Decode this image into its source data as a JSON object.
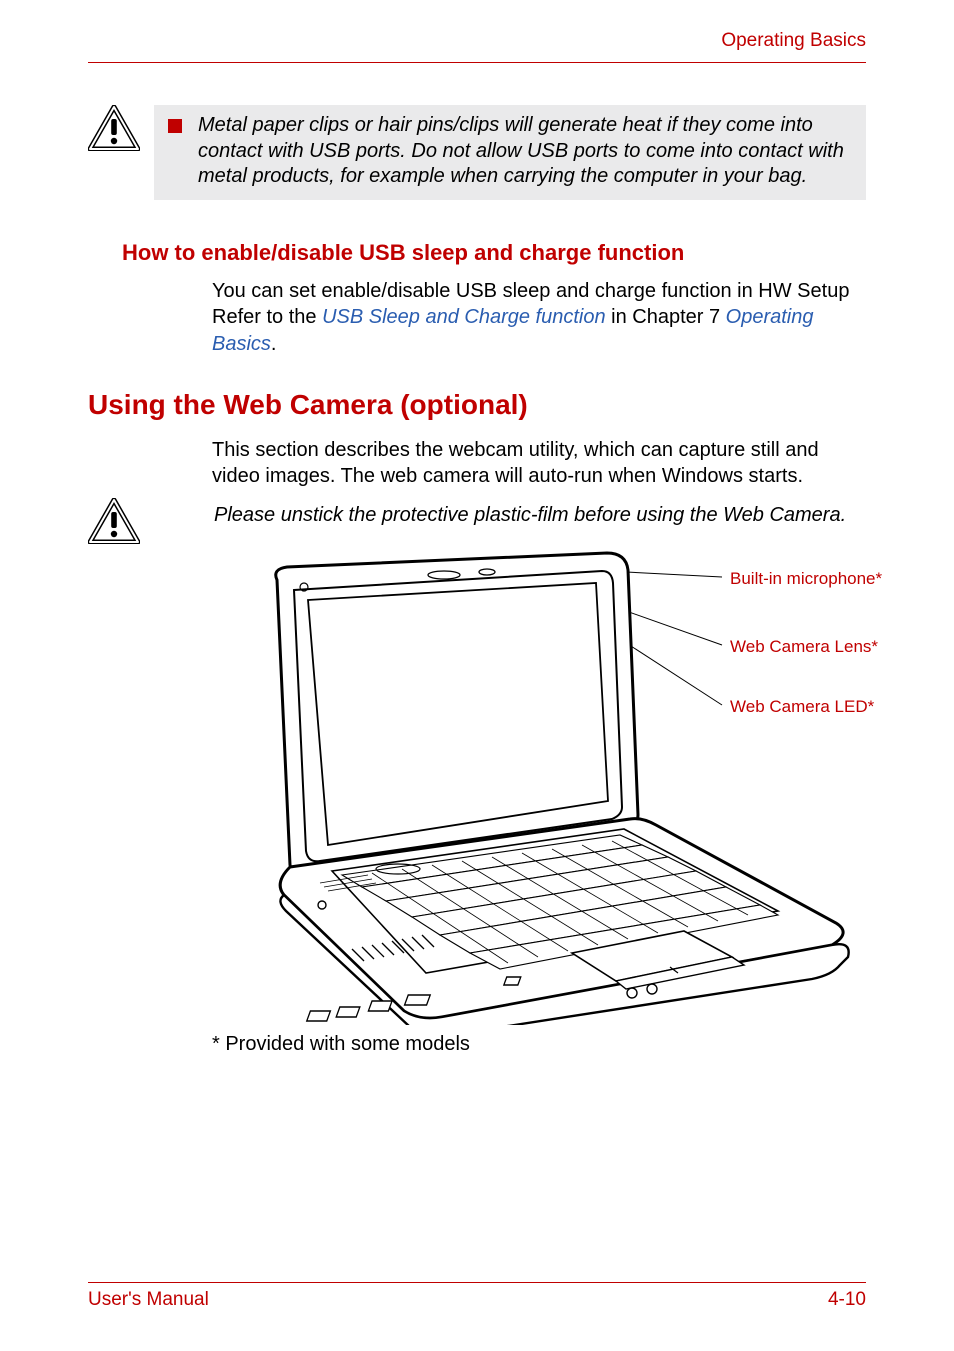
{
  "header": {
    "section": "Operating Basics"
  },
  "callout": {
    "text": "Metal paper clips or hair pins/clips will generate heat if they come into contact with USB ports. Do not allow USB ports to come into contact with metal products, for example when carrying the computer in your bag."
  },
  "subheading": "How to enable/disable USB sleep and charge function",
  "para1": {
    "prefix": "You can set enable/disable USB sleep and charge function in HW Setup Refer to the ",
    "link1": "USB Sleep and Charge function",
    "mid": " in Chapter 7 ",
    "link2": "Operating Basics",
    "suffix": "."
  },
  "h1": "Using the Web Camera (optional)",
  "para2": "This section describes the webcam utility, which can capture still and video images. The web camera will auto-run when Windows starts.",
  "note": "Please unstick the protective plastic-film before using the Web Camera.",
  "labels": {
    "mic": "Built-in microphone*",
    "lens": "Web Camera Lens*",
    "led": "Web Camera LED*"
  },
  "footnote": "* Provided with some models",
  "footer": {
    "left": "User's Manual",
    "right": "4-10"
  }
}
